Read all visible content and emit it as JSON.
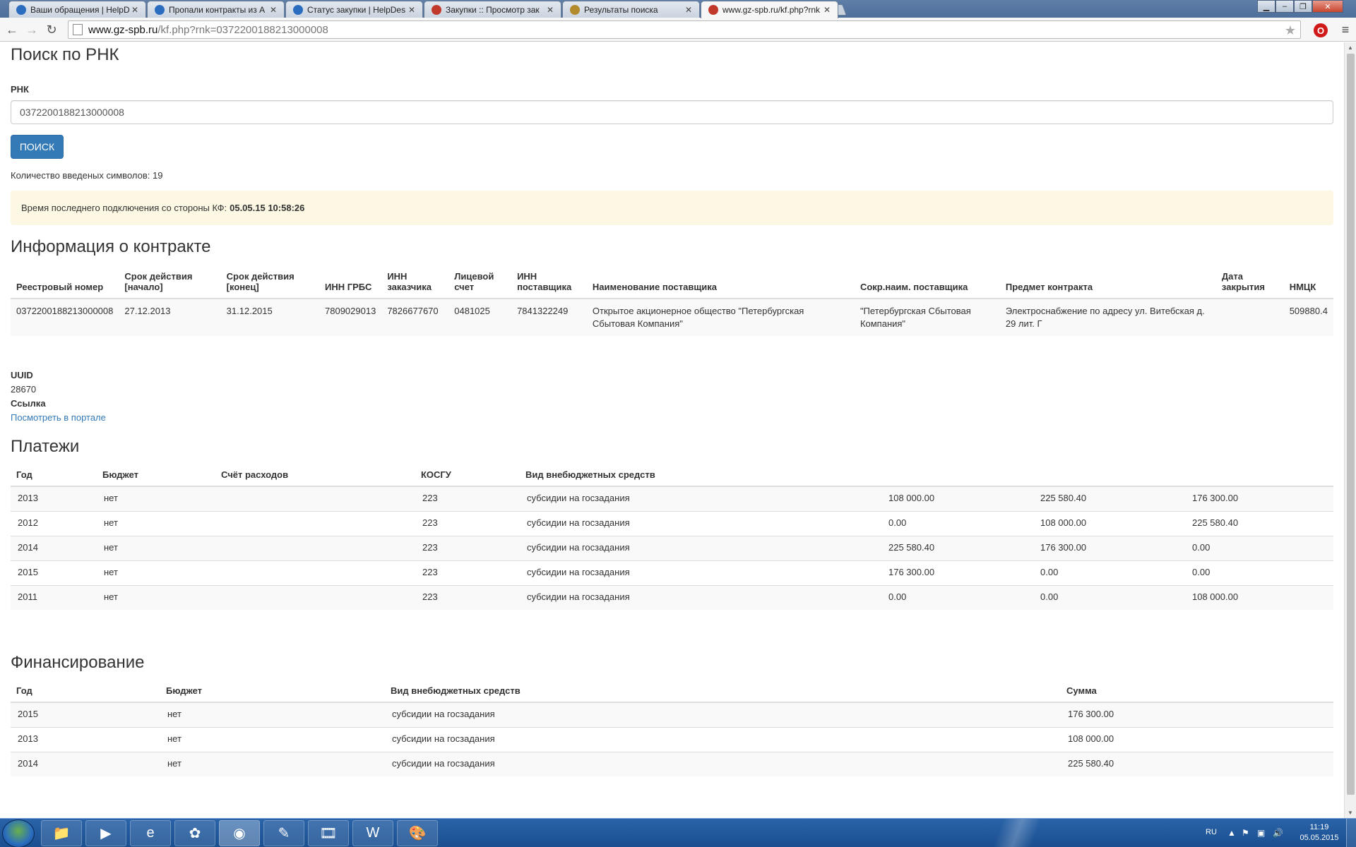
{
  "browser": {
    "tabs": [
      {
        "label": "Ваши обращения | HelpD",
        "icon": "helpdesk-icon",
        "color": "#2a6dbf"
      },
      {
        "label": "Пропали контракты из А",
        "icon": "helpdesk-icon",
        "color": "#2a6dbf"
      },
      {
        "label": "Статус закупки | HelpDes",
        "icon": "helpdesk-icon",
        "color": "#2a6dbf"
      },
      {
        "label": "Закупки :: Просмотр зак",
        "icon": "zakupki-icon",
        "color": "#c0392b"
      },
      {
        "label": "Результаты поиска",
        "icon": "emblem-icon",
        "color": "#b38b2d"
      },
      {
        "label": "www.gz-spb.ru/kf.php?rnk",
        "icon": "gz-spb-icon",
        "color": "#c0392b"
      }
    ],
    "address": {
      "host": "www.gz-spb.ru",
      "path": "/kf.php?rnk=0372200188213000008"
    }
  },
  "search": {
    "title": "Поиск по РНК",
    "field_label": "РНК",
    "value": "0372200188213000008",
    "button_label": "Поиск",
    "char_count_text": "Количество введеных символов: 19"
  },
  "alert": {
    "text": "Время последнего подключения со стороны КФ:",
    "datetime": "05.05.15 10:58:26"
  },
  "contract": {
    "title": "Информация о контракте",
    "headers": [
      "Реестровый номер",
      "Срок действия [начало]",
      "Срок действия [конец]",
      "ИНН ГРБС",
      "ИНН заказчика",
      "Лицевой счет",
      "ИНН поставщика",
      "Наименование поставщика",
      "Сокр.наим. поставщика",
      "Предмет контракта",
      "Дата закрытия",
      "НМЦК"
    ],
    "row": [
      "0372200188213000008",
      "27.12.2013",
      "31.12.2015",
      "7809029013",
      "7826677670",
      "0481025",
      "7841322249",
      "Открытое акционерное общество \"Петербургская Сбытовая Компания\"",
      "\"Петербургская Сбытовая Компания\"",
      "Электроснабжение по адресу ул. Витебская д. 29 лит. Г",
      "",
      "509880.4"
    ]
  },
  "meta": {
    "uuid_label": "UUID",
    "uuid_value": "28670",
    "link_label": "Ссылка",
    "link_text": "Посмотреть в портале"
  },
  "payments": {
    "title": "Платежи",
    "headers": [
      "Год",
      "Бюджет",
      "Счёт расходов",
      "КОСГУ",
      "Вид внебюджетных средств",
      "",
      "",
      ""
    ],
    "rows": [
      [
        "2013",
        "нет",
        "",
        "223",
        "субсидии на госзадания",
        "108 000.00",
        "225 580.40",
        "176 300.00"
      ],
      [
        "2012",
        "нет",
        "",
        "223",
        "субсидии на госзадания",
        "0.00",
        "108 000.00",
        "225 580.40"
      ],
      [
        "2014",
        "нет",
        "",
        "223",
        "субсидии на госзадания",
        "225 580.40",
        "176 300.00",
        "0.00"
      ],
      [
        "2015",
        "нет",
        "",
        "223",
        "субсидии на госзадания",
        "176 300.00",
        "0.00",
        "0.00"
      ],
      [
        "2011",
        "нет",
        "",
        "223",
        "субсидии на госзадания",
        "0.00",
        "0.00",
        "108 000.00"
      ]
    ]
  },
  "financing": {
    "title": "Финансирование",
    "headers": [
      "Год",
      "Бюджет",
      "Вид внебюджетных средств",
      "Сумма"
    ],
    "rows": [
      [
        "2015",
        "нет",
        "субсидии на госзадания",
        "176 300.00"
      ],
      [
        "2013",
        "нет",
        "субсидии на госзадания",
        "108 000.00"
      ],
      [
        "2014",
        "нет",
        "субсидии на госзадания",
        "225 580.40"
      ]
    ]
  },
  "taskbar": {
    "apps": [
      {
        "name": "explorer-icon",
        "glyph": "📁"
      },
      {
        "name": "media-player-icon",
        "glyph": "▶"
      },
      {
        "name": "internet-explorer-icon",
        "glyph": "e"
      },
      {
        "name": "icq-icon",
        "glyph": "✿"
      },
      {
        "name": "chrome-icon",
        "glyph": "◉"
      },
      {
        "name": "notepad-icon",
        "glyph": "✎"
      },
      {
        "name": "movie-maker-icon",
        "glyph": "🎞"
      },
      {
        "name": "word-icon",
        "glyph": "W"
      },
      {
        "name": "paint-icon",
        "glyph": "🎨"
      }
    ],
    "language": "RU",
    "time": "11:19",
    "date": "05.05.2015"
  }
}
